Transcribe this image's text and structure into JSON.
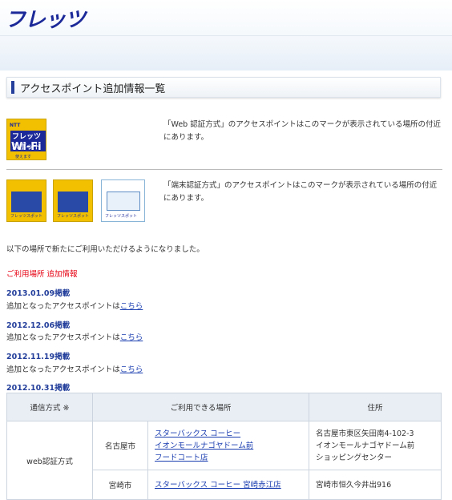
{
  "header": {
    "logo_text": "フレッツ"
  },
  "page_title": "アクセスポイント追加情報一覧",
  "badges": {
    "wifi": {
      "line1": "NTT",
      "line2": "フレッツ スポット",
      "line3": "Wi-Fi",
      "line4": "使えます"
    },
    "terminal_a_label": "フレッツスポット",
    "terminal_b_label": "フレッツスポット",
    "terminal_c_label": "フレッツスポット"
  },
  "descriptions": {
    "web_auth": "「Web 認証方式」のアクセスポイントはこのマークが表示されている場所の付近にあります。",
    "terminal_auth": "「端末認証方式」のアクセスポイントはこのマークが表示されている場所の付近にあります。"
  },
  "note": "以下の場所で新たにご利用いただけるようになりました。",
  "section_title": "ご利用場所 追加情報",
  "updates": [
    {
      "date": "2013.01.09掲載",
      "text": "追加となったアクセスポイントは",
      "link": "こちら"
    },
    {
      "date": "2012.12.06掲載",
      "text": "追加となったアクセスポイントは",
      "link": "こちら"
    },
    {
      "date": "2012.11.19掲載",
      "text": "追加となったアクセスポイントは",
      "link": "こちら"
    }
  ],
  "latest_date": "2012.10.31掲載",
  "table": {
    "headers": {
      "method": "通信方式 ※",
      "place": "ご利用できる場所",
      "address": "住所"
    },
    "method": "web認証方式",
    "rows": [
      {
        "city": "名古屋市",
        "shops": [
          "スターバックス コーヒー",
          "イオンモールナゴヤドーム前",
          "フードコート店"
        ],
        "address": [
          "名古屋市東区矢田南4-102-3",
          "イオンモールナゴヤドーム前",
          "ショッピングセンター"
        ]
      },
      {
        "city": "宮崎市",
        "shops": [
          "スターバックス コーヒー 宮崎赤江店"
        ],
        "address": [
          "宮崎市恒久今井出916"
        ]
      }
    ]
  },
  "colors": {
    "brand": "#1c2a99",
    "accent_red": "#e60012",
    "link": "#1a3db0",
    "badge_yellow": "#f2c000"
  }
}
